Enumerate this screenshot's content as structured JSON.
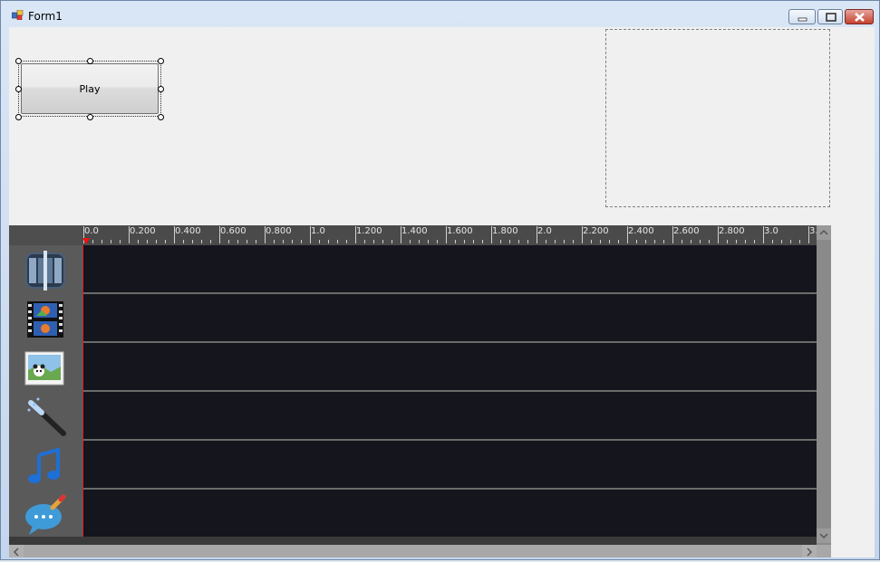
{
  "window": {
    "title": "Form1"
  },
  "toolbar": {
    "play_label": "Play"
  },
  "timeline": {
    "ruler_labels": [
      "0.0",
      "0.200",
      "0.400",
      "0.600",
      "0.800",
      "1.0",
      "1.200",
      "1.400",
      "1.600",
      "1.800",
      "2.0",
      "2.200",
      "2.400",
      "2.600",
      "2.800",
      "3.0",
      "3."
    ],
    "tracks": [
      {
        "icon": "video-transition-icon"
      },
      {
        "icon": "video-clip-icon"
      },
      {
        "icon": "image-icon"
      },
      {
        "icon": "effects-wand-icon"
      },
      {
        "icon": "music-note-icon"
      },
      {
        "icon": "text-caption-icon"
      }
    ]
  },
  "colors": {
    "track_bg": "#15151d",
    "playhead": "#dd2222",
    "ruler_bg": "#4a4a4a"
  }
}
